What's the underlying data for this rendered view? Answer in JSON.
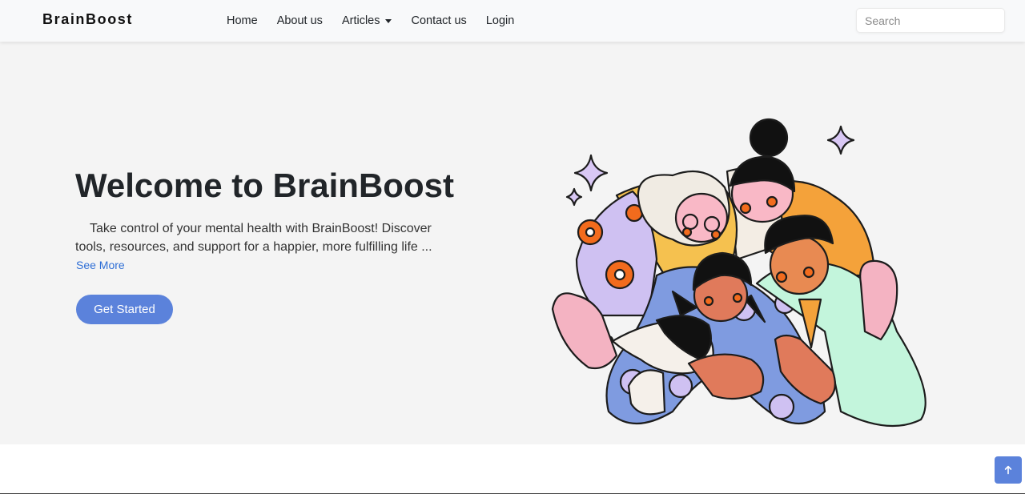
{
  "brand": "BrainBoost",
  "nav": {
    "home": "Home",
    "about": "About us",
    "articles": "Articles",
    "contact": "Contact us",
    "login": "Login"
  },
  "search": {
    "placeholder": "Search"
  },
  "hero": {
    "title": "Welcome to BrainBoost",
    "text": "Take control of your mental health with BrainBoost! Discover tools, resources, and support for a happier, more fulfilling life ...",
    "see_more": "See More",
    "cta": "Get Started"
  },
  "colors": {
    "accent": "#5b82db",
    "link": "#2f6fd6",
    "hero_bg": "#f4f4f4"
  },
  "icons": {
    "articles_dropdown": "caret-down-icon",
    "back_to_top": "arrow-up-icon"
  }
}
